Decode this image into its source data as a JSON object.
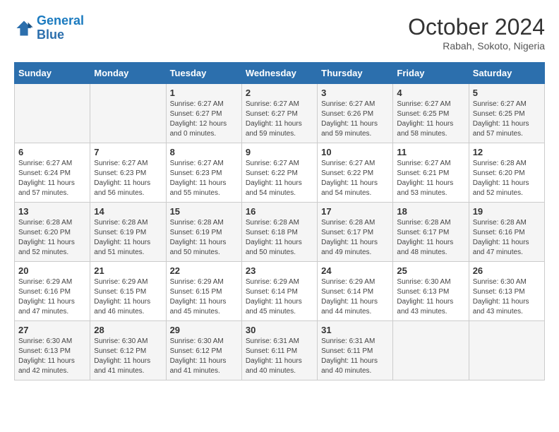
{
  "header": {
    "logo_line1": "General",
    "logo_line2": "Blue",
    "month": "October 2024",
    "location": "Rabah, Sokoto, Nigeria"
  },
  "weekdays": [
    "Sunday",
    "Monday",
    "Tuesday",
    "Wednesday",
    "Thursday",
    "Friday",
    "Saturday"
  ],
  "weeks": [
    [
      {
        "day": "",
        "info": ""
      },
      {
        "day": "",
        "info": ""
      },
      {
        "day": "1",
        "info": "Sunrise: 6:27 AM\nSunset: 6:27 PM\nDaylight: 12 hours\nand 0 minutes."
      },
      {
        "day": "2",
        "info": "Sunrise: 6:27 AM\nSunset: 6:27 PM\nDaylight: 11 hours\nand 59 minutes."
      },
      {
        "day": "3",
        "info": "Sunrise: 6:27 AM\nSunset: 6:26 PM\nDaylight: 11 hours\nand 59 minutes."
      },
      {
        "day": "4",
        "info": "Sunrise: 6:27 AM\nSunset: 6:25 PM\nDaylight: 11 hours\nand 58 minutes."
      },
      {
        "day": "5",
        "info": "Sunrise: 6:27 AM\nSunset: 6:25 PM\nDaylight: 11 hours\nand 57 minutes."
      }
    ],
    [
      {
        "day": "6",
        "info": "Sunrise: 6:27 AM\nSunset: 6:24 PM\nDaylight: 11 hours\nand 57 minutes."
      },
      {
        "day": "7",
        "info": "Sunrise: 6:27 AM\nSunset: 6:23 PM\nDaylight: 11 hours\nand 56 minutes."
      },
      {
        "day": "8",
        "info": "Sunrise: 6:27 AM\nSunset: 6:23 PM\nDaylight: 11 hours\nand 55 minutes."
      },
      {
        "day": "9",
        "info": "Sunrise: 6:27 AM\nSunset: 6:22 PM\nDaylight: 11 hours\nand 54 minutes."
      },
      {
        "day": "10",
        "info": "Sunrise: 6:27 AM\nSunset: 6:22 PM\nDaylight: 11 hours\nand 54 minutes."
      },
      {
        "day": "11",
        "info": "Sunrise: 6:27 AM\nSunset: 6:21 PM\nDaylight: 11 hours\nand 53 minutes."
      },
      {
        "day": "12",
        "info": "Sunrise: 6:28 AM\nSunset: 6:20 PM\nDaylight: 11 hours\nand 52 minutes."
      }
    ],
    [
      {
        "day": "13",
        "info": "Sunrise: 6:28 AM\nSunset: 6:20 PM\nDaylight: 11 hours\nand 52 minutes."
      },
      {
        "day": "14",
        "info": "Sunrise: 6:28 AM\nSunset: 6:19 PM\nDaylight: 11 hours\nand 51 minutes."
      },
      {
        "day": "15",
        "info": "Sunrise: 6:28 AM\nSunset: 6:19 PM\nDaylight: 11 hours\nand 50 minutes."
      },
      {
        "day": "16",
        "info": "Sunrise: 6:28 AM\nSunset: 6:18 PM\nDaylight: 11 hours\nand 50 minutes."
      },
      {
        "day": "17",
        "info": "Sunrise: 6:28 AM\nSunset: 6:17 PM\nDaylight: 11 hours\nand 49 minutes."
      },
      {
        "day": "18",
        "info": "Sunrise: 6:28 AM\nSunset: 6:17 PM\nDaylight: 11 hours\nand 48 minutes."
      },
      {
        "day": "19",
        "info": "Sunrise: 6:28 AM\nSunset: 6:16 PM\nDaylight: 11 hours\nand 47 minutes."
      }
    ],
    [
      {
        "day": "20",
        "info": "Sunrise: 6:29 AM\nSunset: 6:16 PM\nDaylight: 11 hours\nand 47 minutes."
      },
      {
        "day": "21",
        "info": "Sunrise: 6:29 AM\nSunset: 6:15 PM\nDaylight: 11 hours\nand 46 minutes."
      },
      {
        "day": "22",
        "info": "Sunrise: 6:29 AM\nSunset: 6:15 PM\nDaylight: 11 hours\nand 45 minutes."
      },
      {
        "day": "23",
        "info": "Sunrise: 6:29 AM\nSunset: 6:14 PM\nDaylight: 11 hours\nand 45 minutes."
      },
      {
        "day": "24",
        "info": "Sunrise: 6:29 AM\nSunset: 6:14 PM\nDaylight: 11 hours\nand 44 minutes."
      },
      {
        "day": "25",
        "info": "Sunrise: 6:30 AM\nSunset: 6:13 PM\nDaylight: 11 hours\nand 43 minutes."
      },
      {
        "day": "26",
        "info": "Sunrise: 6:30 AM\nSunset: 6:13 PM\nDaylight: 11 hours\nand 43 minutes."
      }
    ],
    [
      {
        "day": "27",
        "info": "Sunrise: 6:30 AM\nSunset: 6:13 PM\nDaylight: 11 hours\nand 42 minutes."
      },
      {
        "day": "28",
        "info": "Sunrise: 6:30 AM\nSunset: 6:12 PM\nDaylight: 11 hours\nand 41 minutes."
      },
      {
        "day": "29",
        "info": "Sunrise: 6:30 AM\nSunset: 6:12 PM\nDaylight: 11 hours\nand 41 minutes."
      },
      {
        "day": "30",
        "info": "Sunrise: 6:31 AM\nSunset: 6:11 PM\nDaylight: 11 hours\nand 40 minutes."
      },
      {
        "day": "31",
        "info": "Sunrise: 6:31 AM\nSunset: 6:11 PM\nDaylight: 11 hours\nand 40 minutes."
      },
      {
        "day": "",
        "info": ""
      },
      {
        "day": "",
        "info": ""
      }
    ]
  ]
}
